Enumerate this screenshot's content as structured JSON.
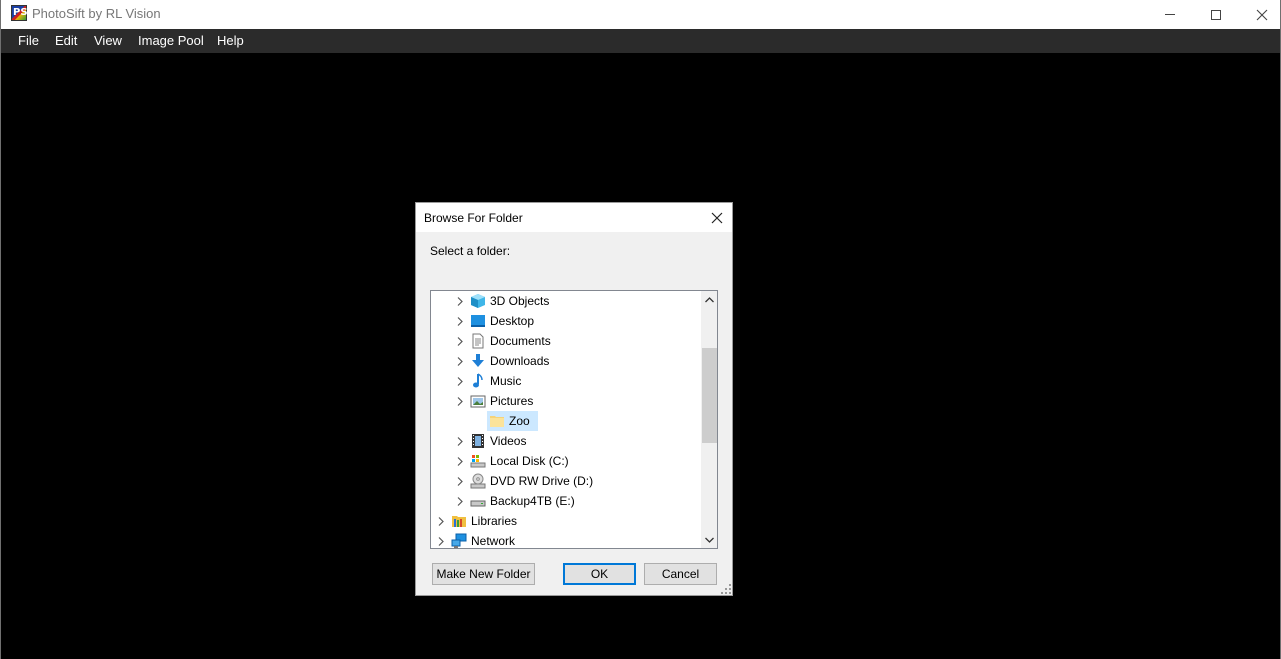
{
  "window": {
    "title": "PhotoSift by RL Vision",
    "icon": "photosift-app-icon",
    "icon_text": "PS"
  },
  "menu": [
    "File",
    "Edit",
    "View",
    "Image Pool",
    "Help"
  ],
  "dialog": {
    "title": "Browse For Folder",
    "prompt": "Select a folder:",
    "tree": [
      {
        "label": "3D Objects",
        "icon": "3d-objects-icon",
        "indent": 1,
        "expandable": true
      },
      {
        "label": "Desktop",
        "icon": "desktop-icon",
        "indent": 1,
        "expandable": true
      },
      {
        "label": "Documents",
        "icon": "documents-icon",
        "indent": 1,
        "expandable": true
      },
      {
        "label": "Downloads",
        "icon": "downloads-icon",
        "indent": 1,
        "expandable": true
      },
      {
        "label": "Music",
        "icon": "music-icon",
        "indent": 1,
        "expandable": true
      },
      {
        "label": "Pictures",
        "icon": "pictures-icon",
        "indent": 1,
        "expandable": true
      },
      {
        "label": "Zoo",
        "icon": "folder-icon",
        "indent": 2,
        "expandable": false,
        "selected": true
      },
      {
        "label": "Videos",
        "icon": "videos-icon",
        "indent": 1,
        "expandable": true
      },
      {
        "label": "Local Disk (C:)",
        "icon": "local-disk-icon",
        "indent": 1,
        "expandable": true
      },
      {
        "label": "DVD RW Drive (D:)",
        "icon": "dvd-drive-icon",
        "indent": 1,
        "expandable": true
      },
      {
        "label": "Backup4TB (E:)",
        "icon": "hard-drive-icon",
        "indent": 1,
        "expandable": true
      },
      {
        "label": "Libraries",
        "icon": "libraries-icon",
        "indent": 0,
        "expandable": true
      },
      {
        "label": "Network",
        "icon": "network-icon",
        "indent": 0,
        "expandable": true
      }
    ],
    "buttons": {
      "make_new_folder": "Make New Folder",
      "ok": "OK",
      "cancel": "Cancel"
    }
  },
  "colors": {
    "menubar": "#2b2b2b",
    "canvas": "#000000",
    "selection": "#cce8ff",
    "default_button_border": "#0078d7"
  }
}
